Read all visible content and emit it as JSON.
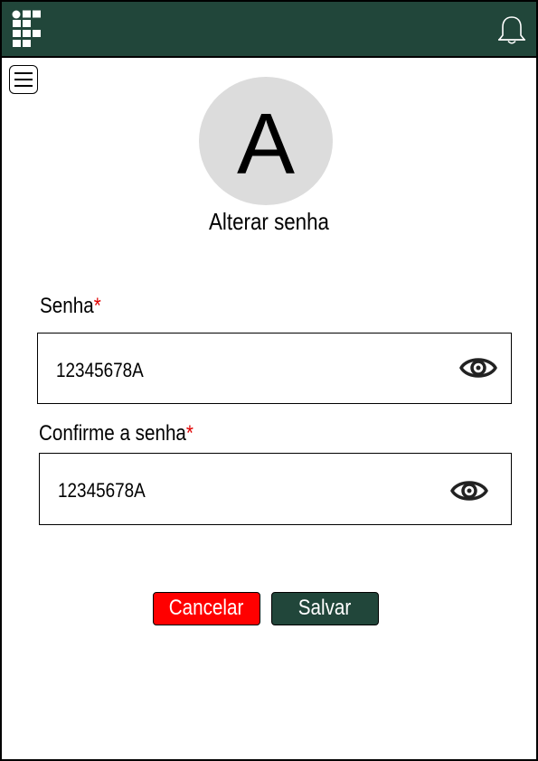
{
  "header": {
    "logo_icon": "institution-logo-icon",
    "notification_icon": "bell-icon",
    "bar_color": "#21463a"
  },
  "menu": {
    "icon": "hamburger-menu-icon"
  },
  "profile": {
    "avatar_letter": "A"
  },
  "page": {
    "title": "Alterar senha"
  },
  "form": {
    "password": {
      "label": "Senha",
      "required_mark": "*",
      "value": "12345678A",
      "toggle_icon": "eye-icon"
    },
    "confirm_password": {
      "label": "Confirme a senha",
      "required_mark": "*",
      "value": "12345678A",
      "toggle_icon": "eye-icon"
    }
  },
  "actions": {
    "cancel_label": "Cancelar",
    "save_label": "Salvar",
    "cancel_color": "#ff0000",
    "save_color": "#21463a"
  }
}
